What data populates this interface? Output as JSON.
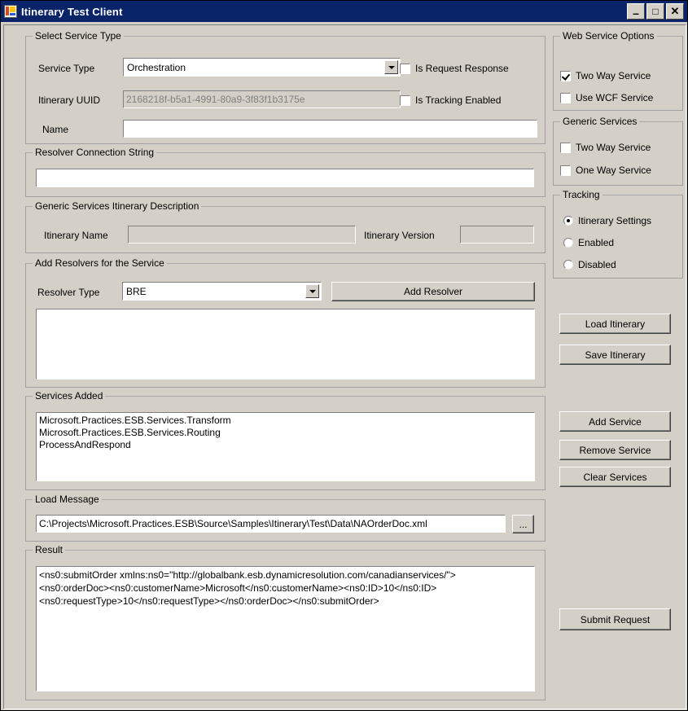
{
  "window": {
    "title": "Itinerary Test Client",
    "icon": "form-icon",
    "minimize_label": "–",
    "maximize_label": "□",
    "close_label": "✕"
  },
  "select_service_type": {
    "title": "Select Service Type",
    "service_type_label": "Service Type",
    "service_type_value": "Orchestration",
    "itinerary_uuid_label": "Itinerary UUID",
    "itinerary_uuid_value": "2168218f-b5a1-4991-80a9-3f83f1b3175e",
    "name_label": "Name",
    "name_value": "",
    "is_request_response_label": "Is Request Response",
    "is_request_response_checked": false,
    "is_tracking_enabled_label": "Is Tracking Enabled",
    "is_tracking_enabled_checked": false
  },
  "resolver_connection_string": {
    "title": "Resolver Connection String",
    "value": ""
  },
  "generic_services_itinerary_description": {
    "title": "Generic Services Itinerary Description",
    "itinerary_name_label": "Itinerary Name",
    "itinerary_name_value": "",
    "itinerary_version_label": "Itinerary Version",
    "itinerary_version_value": ""
  },
  "add_resolvers": {
    "title": "Add Resolvers for the Service",
    "resolver_type_label": "Resolver Type",
    "resolver_type_value": "BRE",
    "add_resolver_label": "Add Resolver",
    "resolvers": []
  },
  "services_added": {
    "title": "Services Added",
    "items": [
      "Microsoft.Practices.ESB.Services.Transform",
      "Microsoft.Practices.ESB.Services.Routing",
      "ProcessAndRespond"
    ]
  },
  "load_message": {
    "title": "Load Message",
    "path": "C:\\Projects\\Microsoft.Practices.ESB\\Source\\Samples\\Itinerary\\Test\\Data\\NAOrderDoc.xml",
    "browse_label": "..."
  },
  "result": {
    "title": "Result",
    "lines": [
      "<ns0:submitOrder xmlns:ns0=\"http://globalbank.esb.dynamicresolution.com/canadianservices/\">",
      "<ns0:orderDoc><ns0:customerName>Microsoft</ns0:customerName><ns0:ID>10</ns0:ID>",
      "<ns0:requestType>10</ns0:requestType></ns0:orderDoc></ns0:submitOrder>"
    ]
  },
  "web_service_options": {
    "title": "Web Service Options",
    "two_way_service_label": "Two Way Service",
    "two_way_service_checked": true,
    "use_wcf_service_label": "Use WCF Service",
    "use_wcf_service_checked": false
  },
  "generic_services": {
    "title": "Generic Services",
    "two_way_service_label": "Two Way Service",
    "two_way_service_checked": false,
    "one_way_service_label": "One Way Service",
    "one_way_service_checked": false
  },
  "tracking": {
    "title": "Tracking",
    "itinerary_settings_label": "Itinerary Settings",
    "itinerary_settings_selected": true,
    "enabled_label": "Enabled",
    "enabled_selected": false,
    "disabled_label": "Disabled",
    "disabled_selected": false
  },
  "side_buttons": {
    "load_itinerary": "Load Itinerary",
    "save_itinerary": "Save Itinerary",
    "add_service": "Add Service",
    "remove_service": "Remove Service",
    "clear_services": "Clear Services",
    "submit_request": "Submit Request"
  },
  "colors": {
    "title_bar": "#0a246a",
    "face": "#d4d0c8",
    "field": "#ffffff",
    "disabled_text": "#808080"
  }
}
